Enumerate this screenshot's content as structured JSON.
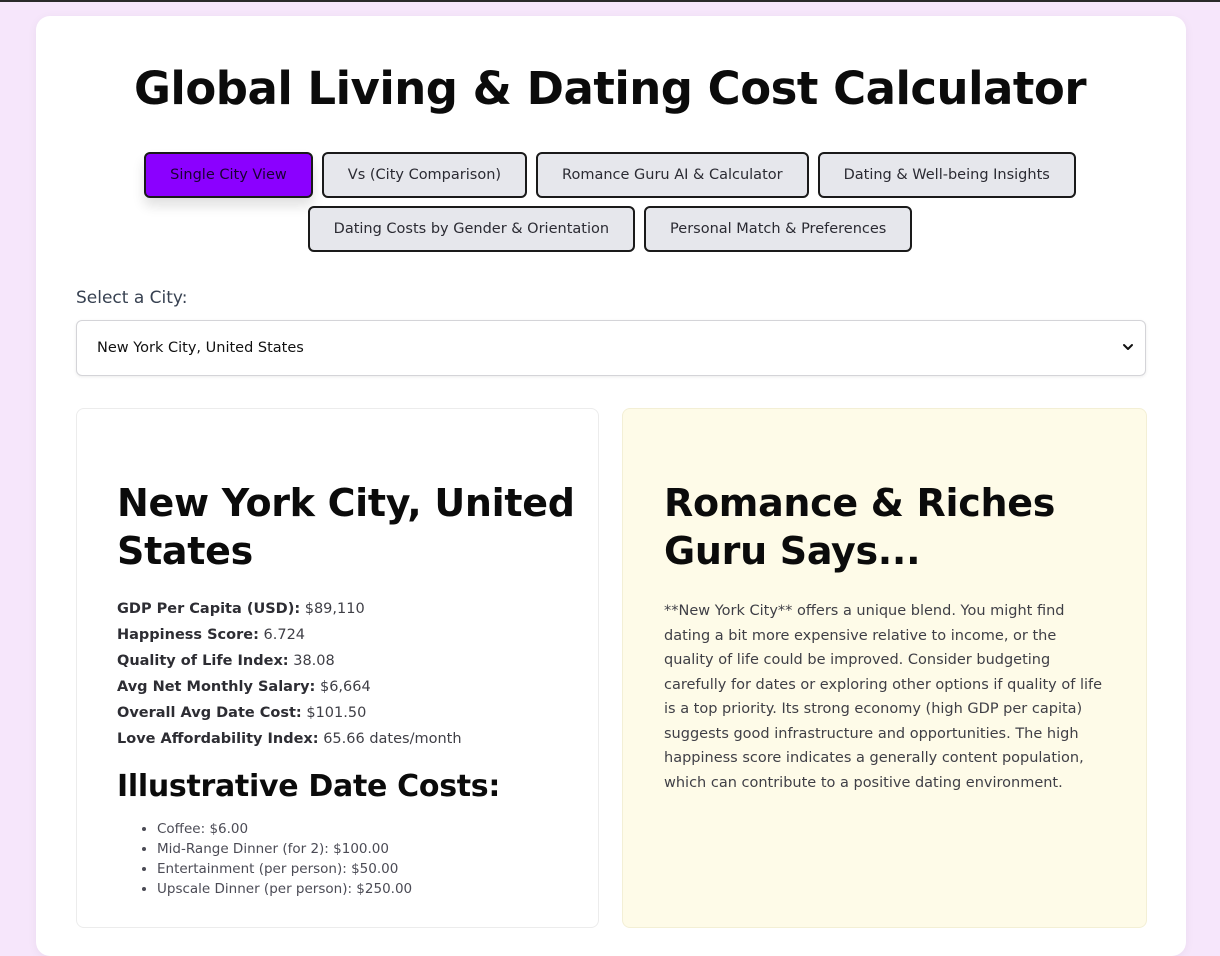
{
  "app": {
    "title": "Global Living & Dating Cost Calculator"
  },
  "tabs": [
    {
      "label": "Single City View",
      "active": true
    },
    {
      "label": "Vs (City Comparison)",
      "active": false
    },
    {
      "label": "Romance Guru AI & Calculator",
      "active": false
    },
    {
      "label": "Dating & Well-being Insights",
      "active": false
    },
    {
      "label": "Dating Costs by Gender & Orientation",
      "active": false
    },
    {
      "label": "Personal Match & Preferences",
      "active": false
    }
  ],
  "city_select": {
    "label": "Select a City:",
    "value": "New York City, United States",
    "icon": "chevron-down-icon"
  },
  "city_panel": {
    "heading": "New York City, United States",
    "stats": [
      {
        "label": "GDP Per Capita (USD):",
        "value": "$89,110"
      },
      {
        "label": "Happiness Score:",
        "value": "6.724"
      },
      {
        "label": "Quality of Life Index:",
        "value": "38.08"
      },
      {
        "label": "Avg Net Monthly Salary:",
        "value": "$6,664"
      },
      {
        "label": "Overall Avg Date Cost:",
        "value": "$101.50"
      },
      {
        "label": "Love Affordability Index:",
        "value": "65.66 dates/month"
      }
    ],
    "costs_heading": "Illustrative Date Costs:",
    "costs": [
      "Coffee: $6.00",
      "Mid-Range Dinner (for 2): $100.00",
      "Entertainment (per person): $50.00",
      "Upscale Dinner (per person): $250.00"
    ]
  },
  "guru_panel": {
    "heading": "Romance & Riches Guru Says...",
    "text": "**New York City** offers a unique blend. You might find dating a bit more expensive relative to income, or the quality of life could be improved. Consider budgeting carefully for dates or exploring other options if quality of life is a top priority. Its strong economy (high GDP per capita) suggests good infrastructure and opportunities. The high happiness score indicates a generally content population, which can contribute to a positive dating environment."
  },
  "colors": {
    "page_bg": "#f6e6fb",
    "active_tab": "#8b00ff",
    "tab_bg": "#e6e7ec",
    "guru_bg": "#fefbe8"
  }
}
